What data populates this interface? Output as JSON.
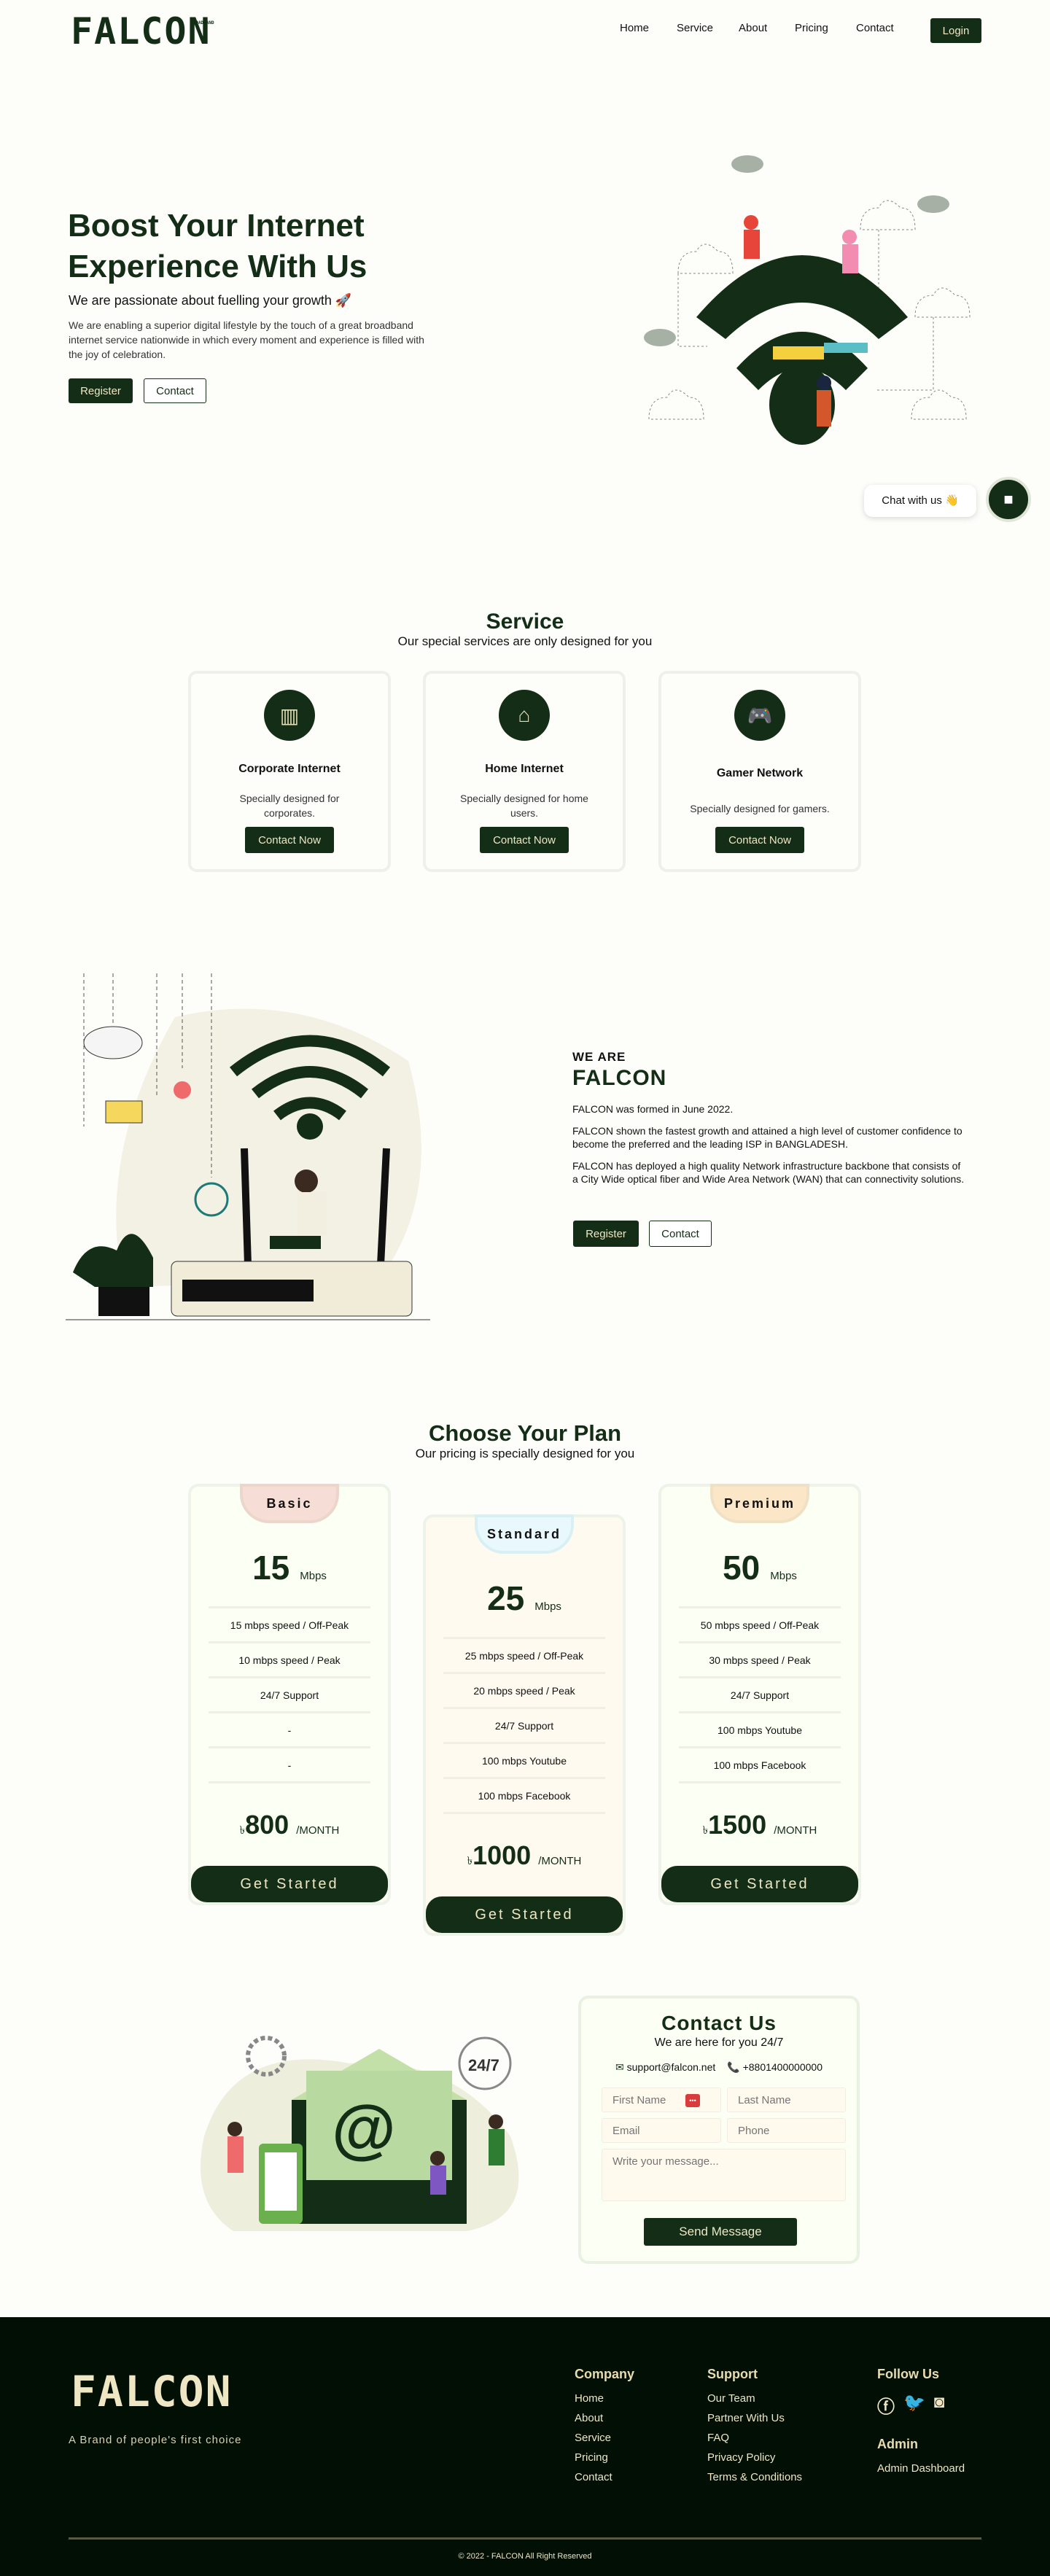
{
  "brand": {
    "name": "FALCON",
    "tagline": "BROADBAND"
  },
  "nav": {
    "items": [
      "Home",
      "Service",
      "About",
      "Pricing",
      "Contact"
    ],
    "login": "Login"
  },
  "hero": {
    "title_line1": "Boost Your Internet",
    "title_line2": "Experience With Us",
    "subtitle": "We are passionate about fuelling your growth 🚀",
    "text": "We are enabling a superior digital lifestyle by the touch of a great broadband internet service nationwide in which every moment and experience is filled with the joy of celebration.",
    "register": "Register",
    "contact": "Contact"
  },
  "chat": {
    "label": "Chat with us 👋"
  },
  "service": {
    "title": "Service",
    "subtitle": "Our special services are only designed for you",
    "cards": [
      {
        "icon": "building-icon",
        "title": "Corporate Internet",
        "text": "Specially designed for corporates.",
        "button": "Contact Now"
      },
      {
        "icon": "home-icon",
        "title": "Home Internet",
        "text": "Specially designed for home users.",
        "button": "Contact Now"
      },
      {
        "icon": "gamepad-icon",
        "title": "Gamer Network",
        "text": "Specially designed for gamers.",
        "button": "Contact Now"
      }
    ]
  },
  "about": {
    "kicker": "WE ARE",
    "title": "FALCON",
    "p1": "FALCON was formed in June 2022.",
    "p2": "FALCON shown the fastest growth and attained a high level of customer confidence to become the preferred and the leading ISP in BANGLADESH.",
    "p3": "FALCON has deployed a high quality Network infrastructure backbone that consists of a City Wide optical fiber and Wide Area Network (WAN) that can connectivity solutions.",
    "register": "Register",
    "contact": "Contact"
  },
  "pricing": {
    "title": "Choose Your Plan",
    "subtitle": "Our pricing is specially designed for you",
    "currency": "৳",
    "period": "/MONTH",
    "unit": "Mbps",
    "button": "Get Started",
    "plans": [
      {
        "name": "Basic",
        "speed": "15",
        "features": [
          "15 mbps speed / Off-Peak",
          "10 mbps speed / Peak",
          "24/7 Support",
          "-",
          "-"
        ],
        "price": "800",
        "tag_bg": "#f6ddd5",
        "tag_border": "#ecd6cc",
        "card_bg": "#fbfff4"
      },
      {
        "name": "Standard",
        "speed": "25",
        "features": [
          "25 mbps speed / Off-Peak",
          "20 mbps speed / Peak",
          "24/7 Support",
          "100 mbps Youtube",
          "100 mbps Facebook"
        ],
        "price": "1000",
        "tag_bg": "#e8f8fd",
        "tag_border": "#d8eff3",
        "card_bg": "#fffaf0"
      },
      {
        "name": "Premium",
        "speed": "50",
        "features": [
          "50 mbps speed / Off-Peak",
          "30 mbps speed / Peak",
          "24/7 Support",
          "100 mbps Youtube",
          "100 mbps Facebook"
        ],
        "price": "1500",
        "tag_bg": "#fbe6c8",
        "tag_border": "#f0e0c4",
        "card_bg": "#fbfff4"
      }
    ]
  },
  "contact": {
    "title": "Contact Us",
    "subtitle": "We are here for you 24/7",
    "email": "support@falcon.net",
    "phone": "+8801400000000",
    "first_name": "First Name",
    "last_name": "Last Name",
    "email_ph": "Email",
    "phone_ph": "Phone",
    "message_ph": "Write your message...",
    "send": "Send Message",
    "illus_text": "24/7"
  },
  "footer": {
    "tagline": "A Brand of people's first choice",
    "company": {
      "title": "Company",
      "links": [
        "Home",
        "About",
        "Service",
        "Pricing",
        "Contact"
      ]
    },
    "support": {
      "title": "Support",
      "links": [
        "Our Team",
        "Partner With Us",
        "FAQ",
        "Privacy Policy",
        "Terms & Conditions"
      ]
    },
    "follow": "Follow Us",
    "admin": {
      "title": "Admin",
      "link": "Admin Dashboard"
    },
    "copyright": "© 2022 - FALCON All Right Reserved"
  },
  "colors": {
    "primary": "#132d16",
    "cream": "#efe6c4",
    "footer_bg": "#020f04"
  }
}
